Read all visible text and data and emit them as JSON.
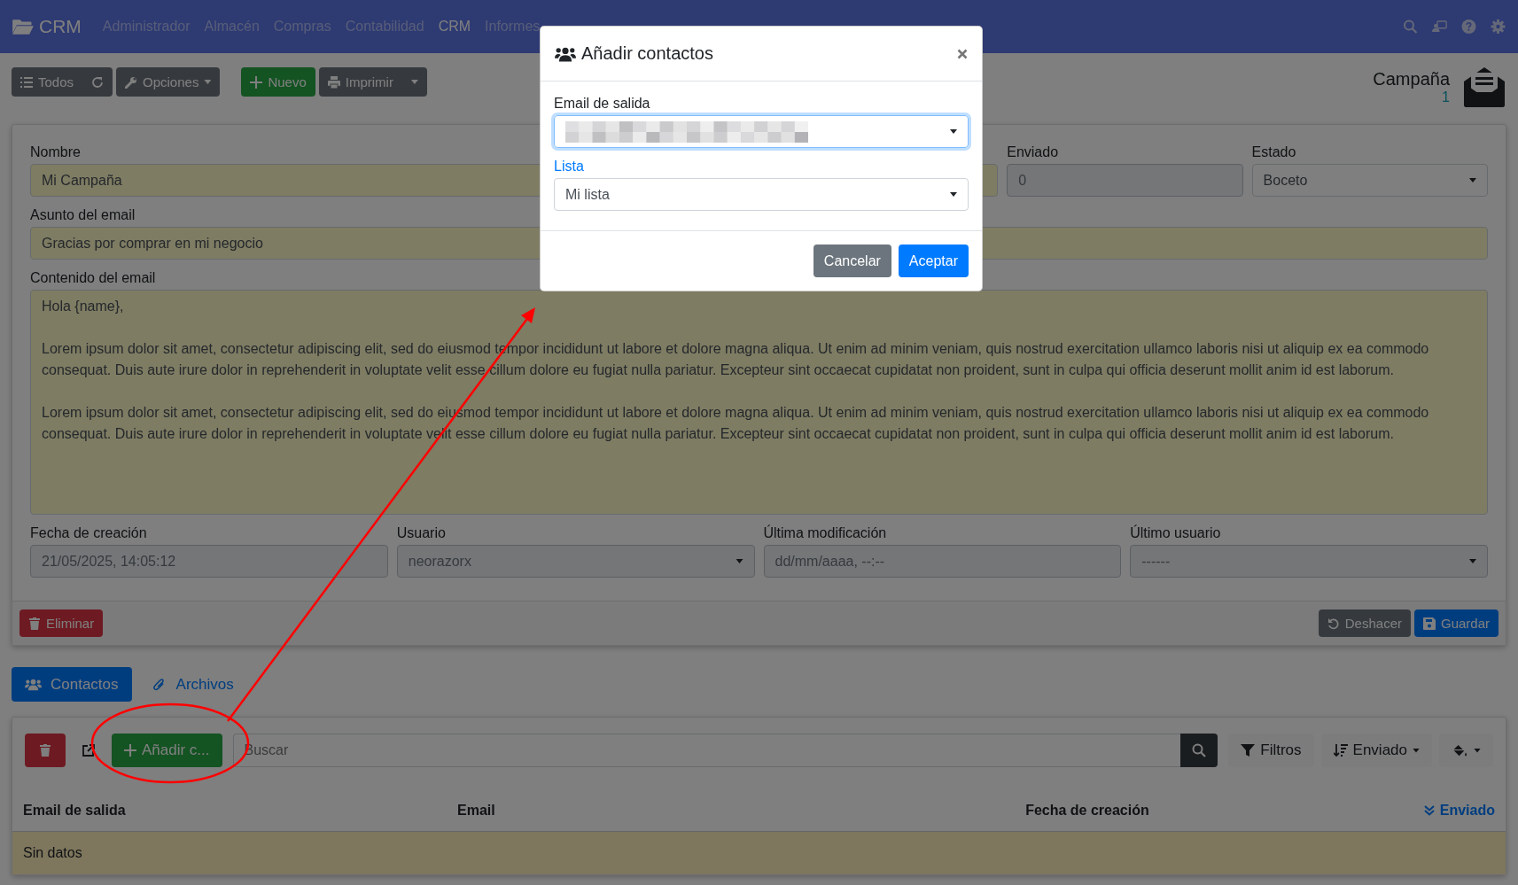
{
  "navbar": {
    "brand": "CRM",
    "menu": [
      {
        "label": "Administrador",
        "selected": false
      },
      {
        "label": "Almacén",
        "selected": false
      },
      {
        "label": "Compras",
        "selected": false
      },
      {
        "label": "Contabilidad",
        "selected": false
      },
      {
        "label": "CRM",
        "selected": true
      },
      {
        "label": "Informes",
        "selected": false
      }
    ]
  },
  "toolbar": {
    "all_button": "Todos",
    "options_button": "Opciones",
    "new_button": "Nuevo",
    "print_button": "Imprimir"
  },
  "header": {
    "title": "Campaña",
    "count": "1"
  },
  "form": {
    "rows": [
      [
        {
          "label": "Nombre",
          "value": "Mi Campaña",
          "kind": "input",
          "required": true,
          "disabled": false
        },
        {
          "label": "Enviado",
          "value": "0",
          "kind": "input",
          "required": false,
          "disabled": true
        },
        {
          "label": "Estado",
          "value": "Boceto",
          "kind": "select",
          "required": false,
          "disabled": false
        }
      ],
      [
        {
          "label": "Asunto del email",
          "value": "Gracias por comprar en mi negocio",
          "kind": "input",
          "required": true,
          "disabled": false
        }
      ],
      [
        {
          "label": "Contenido del email",
          "value": "Hola {name},\n\nLorem ipsum dolor sit amet, consectetur adipiscing elit, sed do eiusmod tempor incididunt ut labore et dolore magna aliqua. Ut enim ad minim veniam, quis nostrud exercitation ullamco laboris nisi ut aliquip ex ea commodo consequat. Duis aute irure dolor in reprehenderit in voluptate velit esse cillum dolore eu fugiat nulla pariatur. Excepteur sint occaecat cupidatat non proident, sunt in culpa qui officia deserunt mollit anim id est laborum.\n\nLorem ipsum dolor sit amet, consectetur adipiscing elit, sed do eiusmod tempor incididunt ut labore et dolore magna aliqua. Ut enim ad minim veniam, quis nostrud exercitation ullamco laboris nisi ut aliquip ex ea commodo consequat. Duis aute irure dolor in reprehenderit in voluptate velit esse cillum dolore eu fugiat nulla pariatur. Excepteur sint occaecat cupidatat non proident, sunt in culpa qui officia deserunt mollit anim id est laborum.",
          "kind": "textarea",
          "required": true,
          "disabled": false
        }
      ],
      [
        {
          "label": "Fecha de creación",
          "value": "21/05/2025, 14:05:12",
          "kind": "input",
          "required": false,
          "disabled": true
        },
        {
          "label": "Usuario",
          "value": "neorazorx",
          "kind": "select",
          "required": false,
          "disabled": true
        },
        {
          "label": "Última modificación",
          "value": "dd/mm/aaaa, --:--",
          "kind": "input",
          "required": false,
          "disabled": true
        },
        {
          "label": "Último usuario",
          "value": "------",
          "kind": "select",
          "required": false,
          "disabled": true
        }
      ]
    ],
    "delete_button": "Eliminar",
    "undo_button": "Deshacer",
    "save_button": "Guardar"
  },
  "tabs": [
    {
      "label": "Contactos",
      "selected": true
    },
    {
      "label": "Archivos",
      "selected": false
    }
  ],
  "list": {
    "add_button": "Añadir c...",
    "search": {
      "placeholder": "Buscar"
    },
    "filters_button": "Filtros",
    "sort_button": "Enviado",
    "columns": [
      {
        "label": "Email de salida",
        "sorted": false
      },
      {
        "label": "Email",
        "sorted": false
      },
      {
        "label": "Fecha de creación",
        "sorted": false
      },
      {
        "label": "Enviado",
        "sorted": true
      }
    ],
    "empty_text": "Sin datos"
  },
  "modal": {
    "title": "Añadir contactos",
    "fields": [
      {
        "label": "Email de salida",
        "redacted": true,
        "focused": true,
        "linked": false
      },
      {
        "label": "Lista",
        "value": "Mi lista",
        "redacted": false,
        "focused": false,
        "linked": true
      }
    ],
    "cancel_button": "Cancelar",
    "accept_button": "Aceptar"
  }
}
